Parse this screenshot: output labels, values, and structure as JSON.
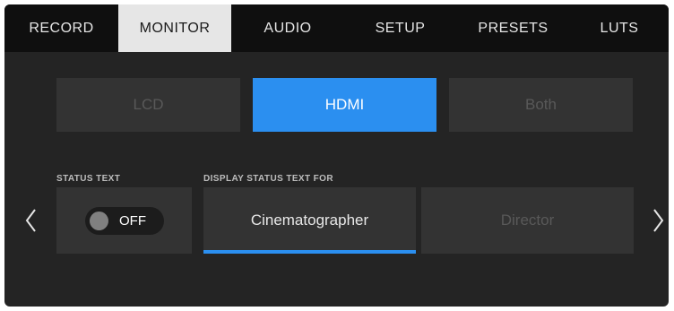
{
  "tabs": [
    {
      "label": "RECORD"
    },
    {
      "label": "MONITOR",
      "active": true
    },
    {
      "label": "AUDIO"
    },
    {
      "label": "SETUP"
    },
    {
      "label": "PRESETS"
    },
    {
      "label": "LUTS"
    }
  ],
  "output_select": {
    "options": [
      "LCD",
      "HDMI",
      "Both"
    ],
    "selected": "HDMI"
  },
  "status_text": {
    "caption": "STATUS TEXT",
    "toggle_label": "OFF",
    "enabled": false
  },
  "display_for": {
    "caption": "DISPLAY STATUS TEXT FOR",
    "options": [
      "Cinematographer",
      "Director"
    ],
    "selected": "Cinematographer"
  },
  "icons": {
    "prev": "chevron-left-icon",
    "next": "chevron-right-icon"
  },
  "colors": {
    "accent": "#2b8ff0",
    "background": "#242424",
    "tab_bar": "#0f0f0f",
    "active_tab": "#e6e6e6"
  }
}
